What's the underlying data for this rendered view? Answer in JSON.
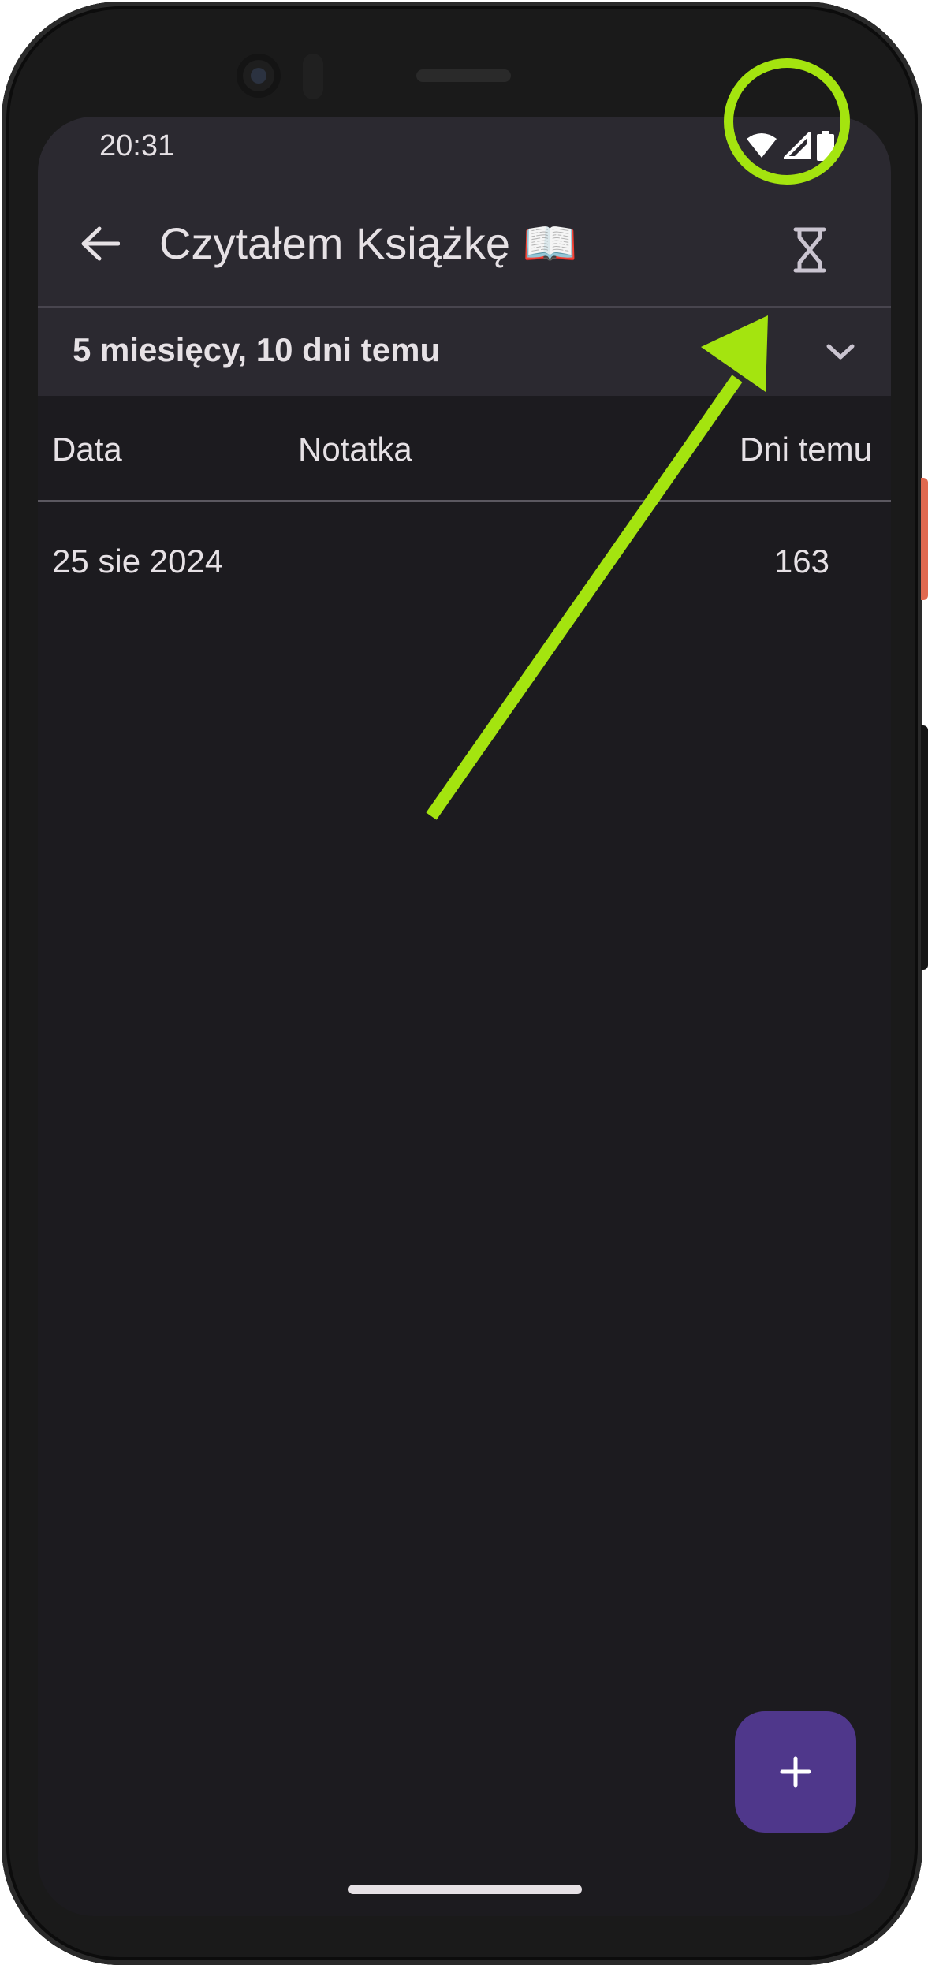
{
  "status_bar": {
    "time": "20:31",
    "icons": [
      "wifi-icon",
      "signal-icon",
      "battery-icon"
    ]
  },
  "app_bar": {
    "back_icon": "arrow-left-icon",
    "title": "Czytałem Książkę 📖",
    "action_icon": "hourglass-icon"
  },
  "range_selector": {
    "label": "5 miesięcy, 10 dni temu",
    "icon": "chevron-down-icon"
  },
  "table": {
    "headers": {
      "date": "Data",
      "note": "Notatka",
      "days_ago": "Dni temu"
    },
    "rows": [
      {
        "date": "25 sie 2024",
        "note": "",
        "days_ago": "163"
      }
    ]
  },
  "fab": {
    "label": "+",
    "icon": "plus-icon"
  },
  "annotation": {
    "ring_color": "#a4e40f",
    "arrow_color": "#a4e40f"
  },
  "colors": {
    "surface": "#1c1b1f",
    "app_bar": "#2b2930",
    "fab": "#4f378b",
    "text": "#e6e1e5"
  }
}
